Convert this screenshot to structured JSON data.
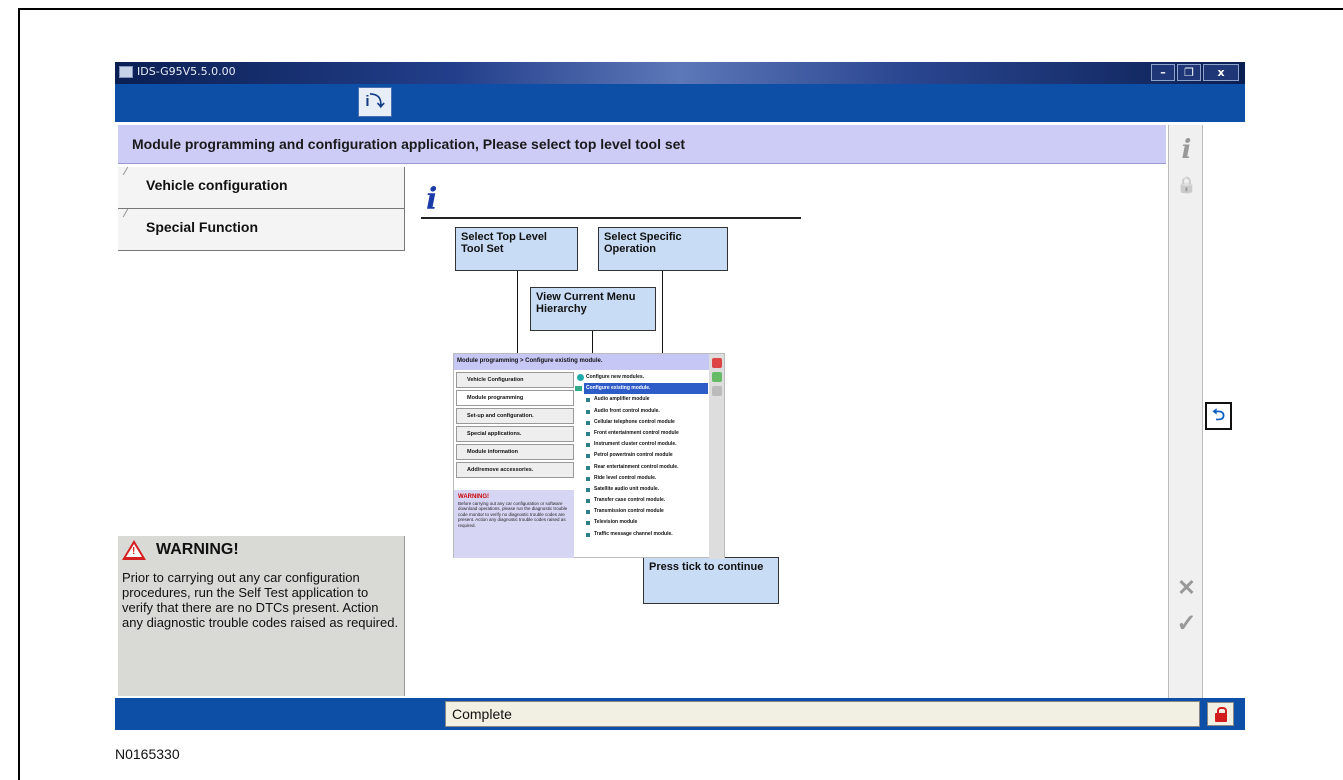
{
  "window": {
    "title": "IDS-G95V5.5.0.00",
    "minimize": "–",
    "maximize": "❐",
    "close": "x",
    "toolbar_icon": "i⤵"
  },
  "header": {
    "text": "Module programming and configuration application, Please select top level tool set"
  },
  "nav": {
    "items": [
      {
        "label": "Vehicle configuration"
      },
      {
        "label": "Special Function"
      }
    ]
  },
  "warning": {
    "title": "WARNING!",
    "text": "Prior to carrying out any car configuration procedures, run the Self Test application to verify that there are no DTCs present. Action any diagnostic trouble codes raised as required."
  },
  "info": {
    "icon": "i"
  },
  "callouts": {
    "select_top": "Select Top Level Tool Set",
    "select_specific": "Select Specific Operation",
    "view_hierarchy": "View Current Menu Hierarchy",
    "press_tick": "Press tick to continue"
  },
  "inner": {
    "header": "Module programming > Configure existing module.",
    "buttons": [
      "Vehicle Configuration",
      "Module programming",
      "Set-up and configuration.",
      "Special applications.",
      "Module information",
      "Add/remove accessories."
    ],
    "warning_title": "WARNING!",
    "warning_text": "Before carrying out any car configuration or software download operations, please run the diagnostic trouble code monitor to verify no diagnostic trouble codes are present. Action any diagnostic trouble codes raised as required.",
    "list": [
      "Configure new modules.",
      "Configure existing module.",
      "Audio amplifier module",
      "Audio front control module.",
      "Cellular telephone control module",
      "Front entertainment control module",
      "Instrument cluster control module.",
      "Petrol powertrain control module",
      "Rear entertainment control module.",
      "Ride level control module.",
      "Satellite audio unit module.",
      "Transfer case control module.",
      "Transmission control module",
      "Television module",
      "Traffic message channel module."
    ]
  },
  "rightbar": {
    "info": "i",
    "lock": "🔒",
    "cancel": "✕",
    "tick": "✓"
  },
  "back_button": "⮌",
  "status": {
    "text": "Complete"
  },
  "caption": "N0165330",
  "colors": {
    "toolbar_blue": "#0d4ea6",
    "header_lilac": "#ccccf7",
    "callout_blue": "#c8dcf5",
    "warning_red": "#d42020"
  }
}
